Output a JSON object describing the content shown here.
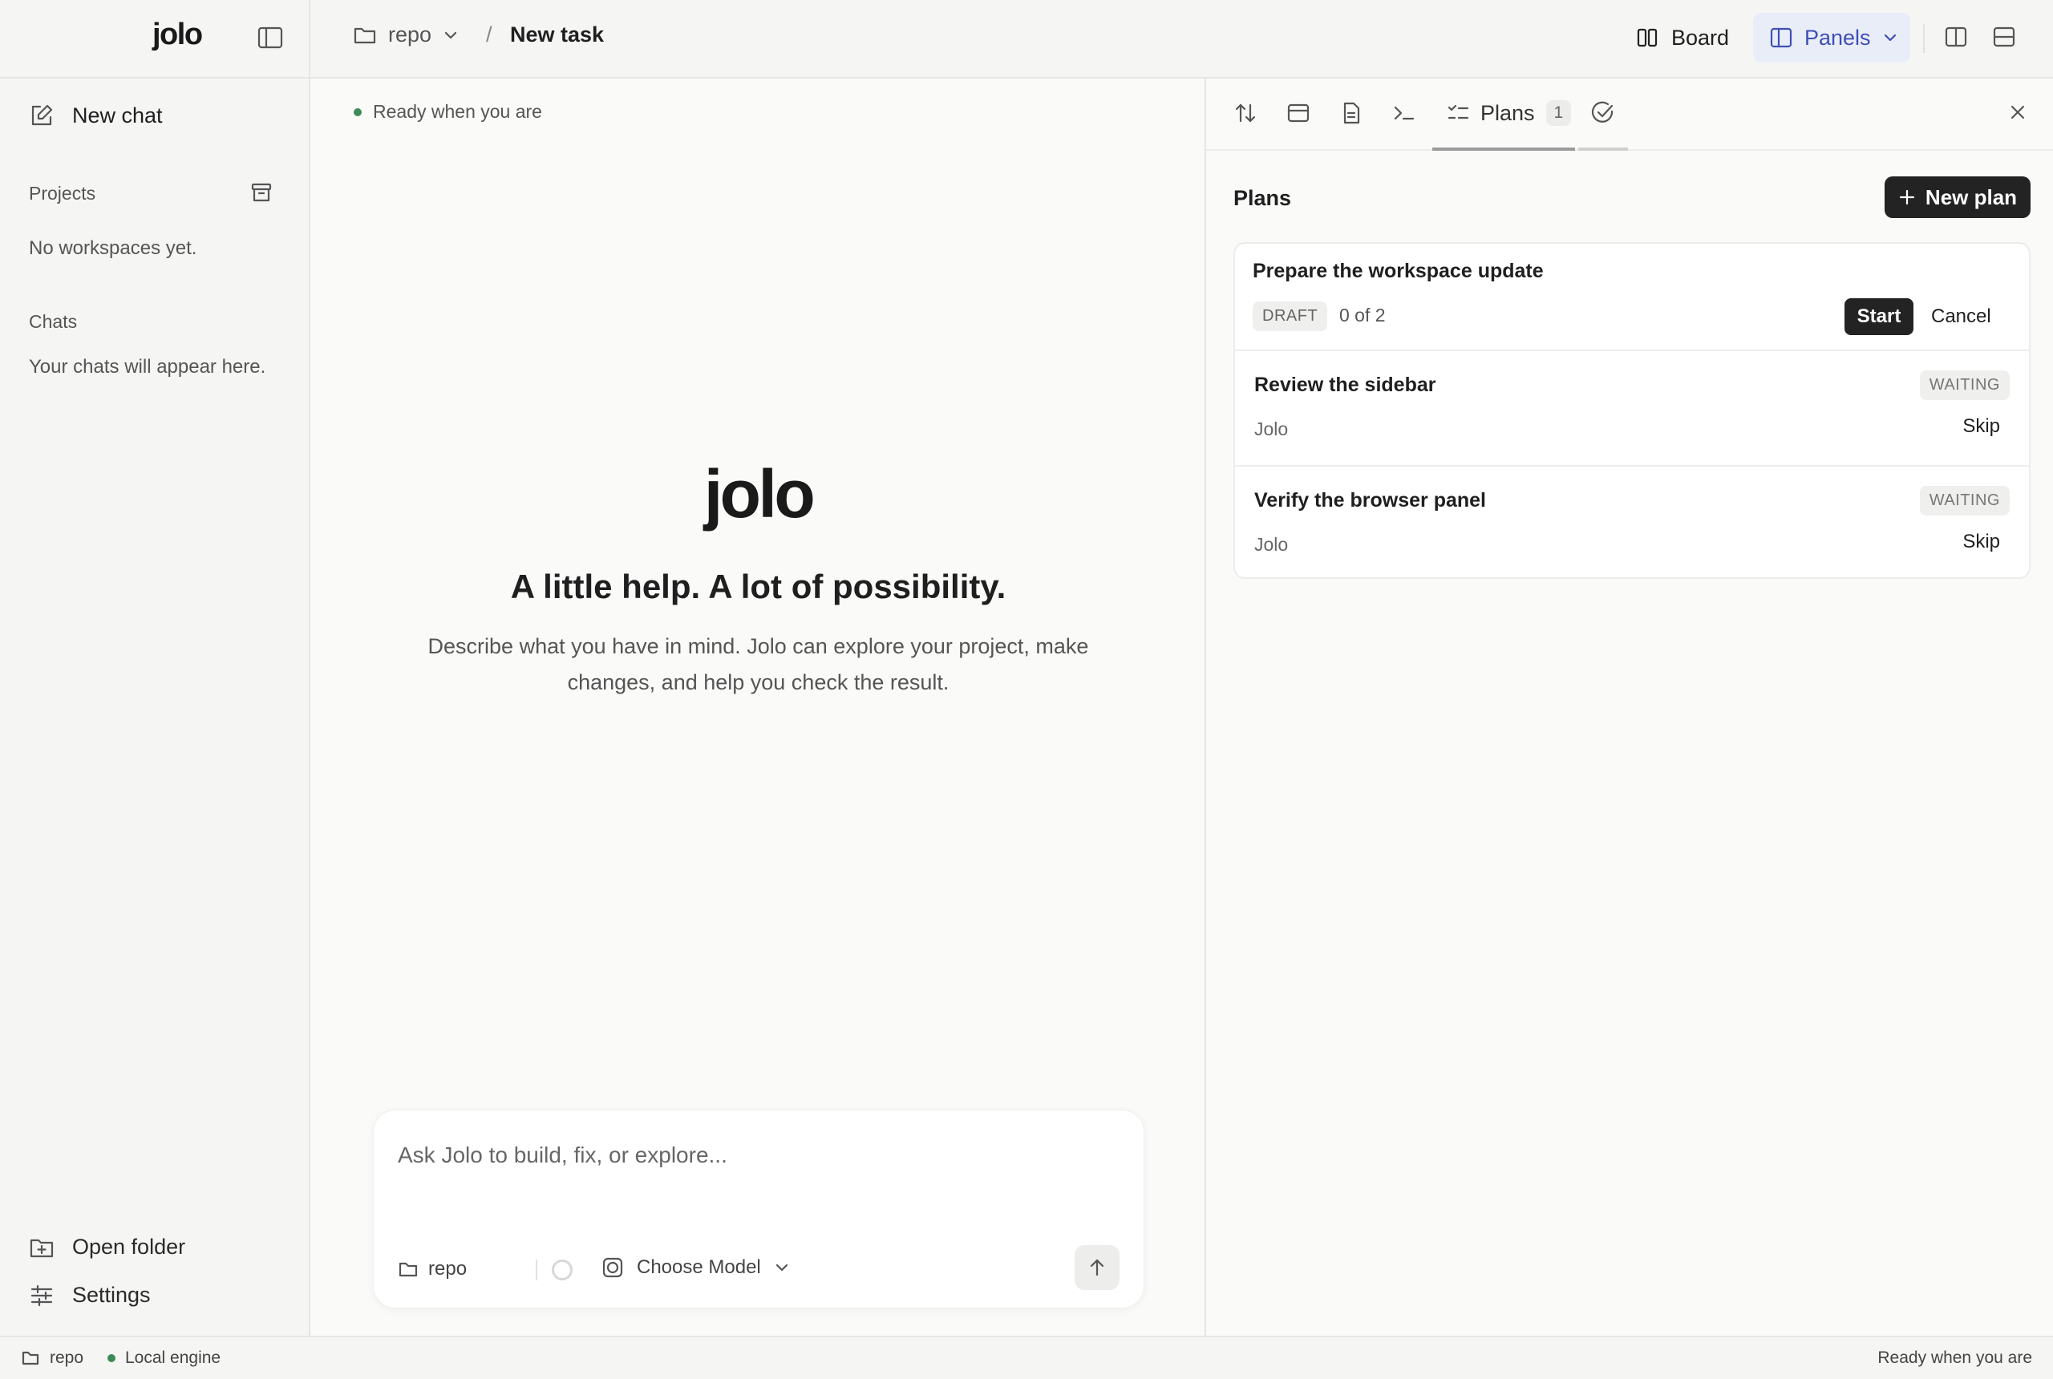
{
  "app": {
    "logo": "jolo"
  },
  "header": {
    "repo": "repo",
    "separator": "/",
    "task": "New task",
    "board_label": "Board",
    "panels_label": "Panels"
  },
  "sidebar": {
    "new_chat": "New chat",
    "projects_title": "Projects",
    "projects_empty": "No workspaces yet.",
    "chats_title": "Chats",
    "chats_empty": "Your chats will appear here.",
    "open_folder": "Open folder",
    "settings": "Settings"
  },
  "center": {
    "status": "Ready when you are",
    "hero_logo": "jolo",
    "hero_title": "A little help. A lot of possibility.",
    "hero_subtitle": "Describe what you have in mind. Jolo can explore your project, make changes, and help you check the result.",
    "composer": {
      "placeholder": "Ask Jolo to build, fix, or explore...",
      "repo": "repo",
      "model": "Choose Model"
    }
  },
  "panel": {
    "tabs": {
      "plans_label": "Plans",
      "plans_count": "1"
    },
    "title": "Plans",
    "new_plan_label": "New plan",
    "plan": {
      "name": "Prepare the workspace update",
      "status": "DRAFT",
      "progress": "0 of 2",
      "start_label": "Start",
      "cancel_label": "Cancel",
      "steps": [
        {
          "title": "Review the sidebar",
          "owner": "Jolo",
          "status": "WAITING",
          "action": "Skip"
        },
        {
          "title": "Verify the browser panel",
          "owner": "Jolo",
          "status": "WAITING",
          "action": "Skip"
        }
      ]
    }
  },
  "statusbar": {
    "repo": "repo",
    "engine": "Local engine",
    "right": "Ready when you are"
  },
  "colors": {
    "accent_blue": "#3f4fb5",
    "status_green": "#3d8b55",
    "primary_button": "#232323"
  }
}
